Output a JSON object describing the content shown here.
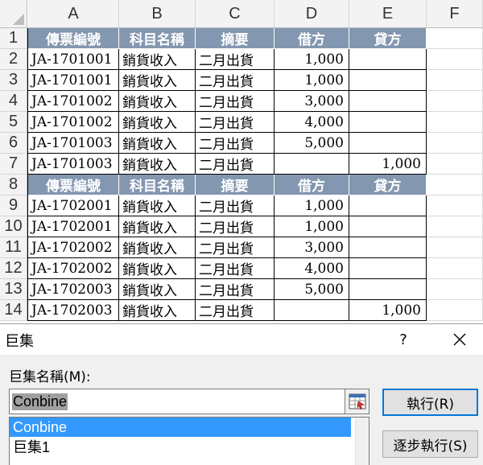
{
  "spreadsheet": {
    "column_letters": [
      "A",
      "B",
      "C",
      "D",
      "E",
      "F"
    ],
    "row_numbers": [
      "1",
      "2",
      "3",
      "4",
      "5",
      "6",
      "7",
      "8",
      "9",
      "10",
      "11",
      "12",
      "13",
      "14"
    ],
    "rows": [
      {
        "type": "header",
        "cells": [
          "傳票編號",
          "科目名稱",
          "摘要",
          "借方",
          "貸方"
        ]
      },
      {
        "type": "data",
        "cells": [
          "JA-1701001",
          "銷貨收入",
          "二月出貨",
          "1,000",
          ""
        ]
      },
      {
        "type": "data",
        "cells": [
          "JA-1701001",
          "銷貨收入",
          "二月出貨",
          "1,000",
          ""
        ]
      },
      {
        "type": "data",
        "cells": [
          "JA-1701002",
          "銷貨收入",
          "二月出貨",
          "3,000",
          ""
        ]
      },
      {
        "type": "data",
        "cells": [
          "JA-1701002",
          "銷貨收入",
          "二月出貨",
          "4,000",
          ""
        ]
      },
      {
        "type": "data",
        "cells": [
          "JA-1701003",
          "銷貨收入",
          "二月出貨",
          "5,000",
          ""
        ]
      },
      {
        "type": "data",
        "cells": [
          "JA-1701003",
          "銷貨收入",
          "二月出貨",
          "",
          "1,000"
        ]
      },
      {
        "type": "header",
        "cells": [
          "傳票編號",
          "科目名稱",
          "摘要",
          "借方",
          "貸方"
        ]
      },
      {
        "type": "data",
        "cells": [
          "JA-1702001",
          "銷貨收入",
          "二月出貨",
          "1,000",
          ""
        ]
      },
      {
        "type": "data",
        "cells": [
          "JA-1702001",
          "銷貨收入",
          "二月出貨",
          "1,000",
          ""
        ]
      },
      {
        "type": "data",
        "cells": [
          "JA-1702002",
          "銷貨收入",
          "二月出貨",
          "3,000",
          ""
        ]
      },
      {
        "type": "data",
        "cells": [
          "JA-1702002",
          "銷貨收入",
          "二月出貨",
          "4,000",
          ""
        ]
      },
      {
        "type": "data",
        "cells": [
          "JA-1702003",
          "銷貨收入",
          "二月出貨",
          "5,000",
          ""
        ]
      },
      {
        "type": "data",
        "cells": [
          "JA-1702003",
          "銷貨收入",
          "二月出貨",
          "",
          "1,000"
        ]
      }
    ],
    "header_color": "#8497b0"
  },
  "dialog": {
    "title": "巨集",
    "help_label": "?",
    "name_label": "巨集名稱(M):",
    "name_value": "Conbine",
    "macros": [
      "Conbine",
      "巨集1"
    ],
    "selected_macro": "Conbine",
    "run_label": "執行(R)",
    "step_label": "逐步執行(S)",
    "accent_color": "#3399ff"
  }
}
